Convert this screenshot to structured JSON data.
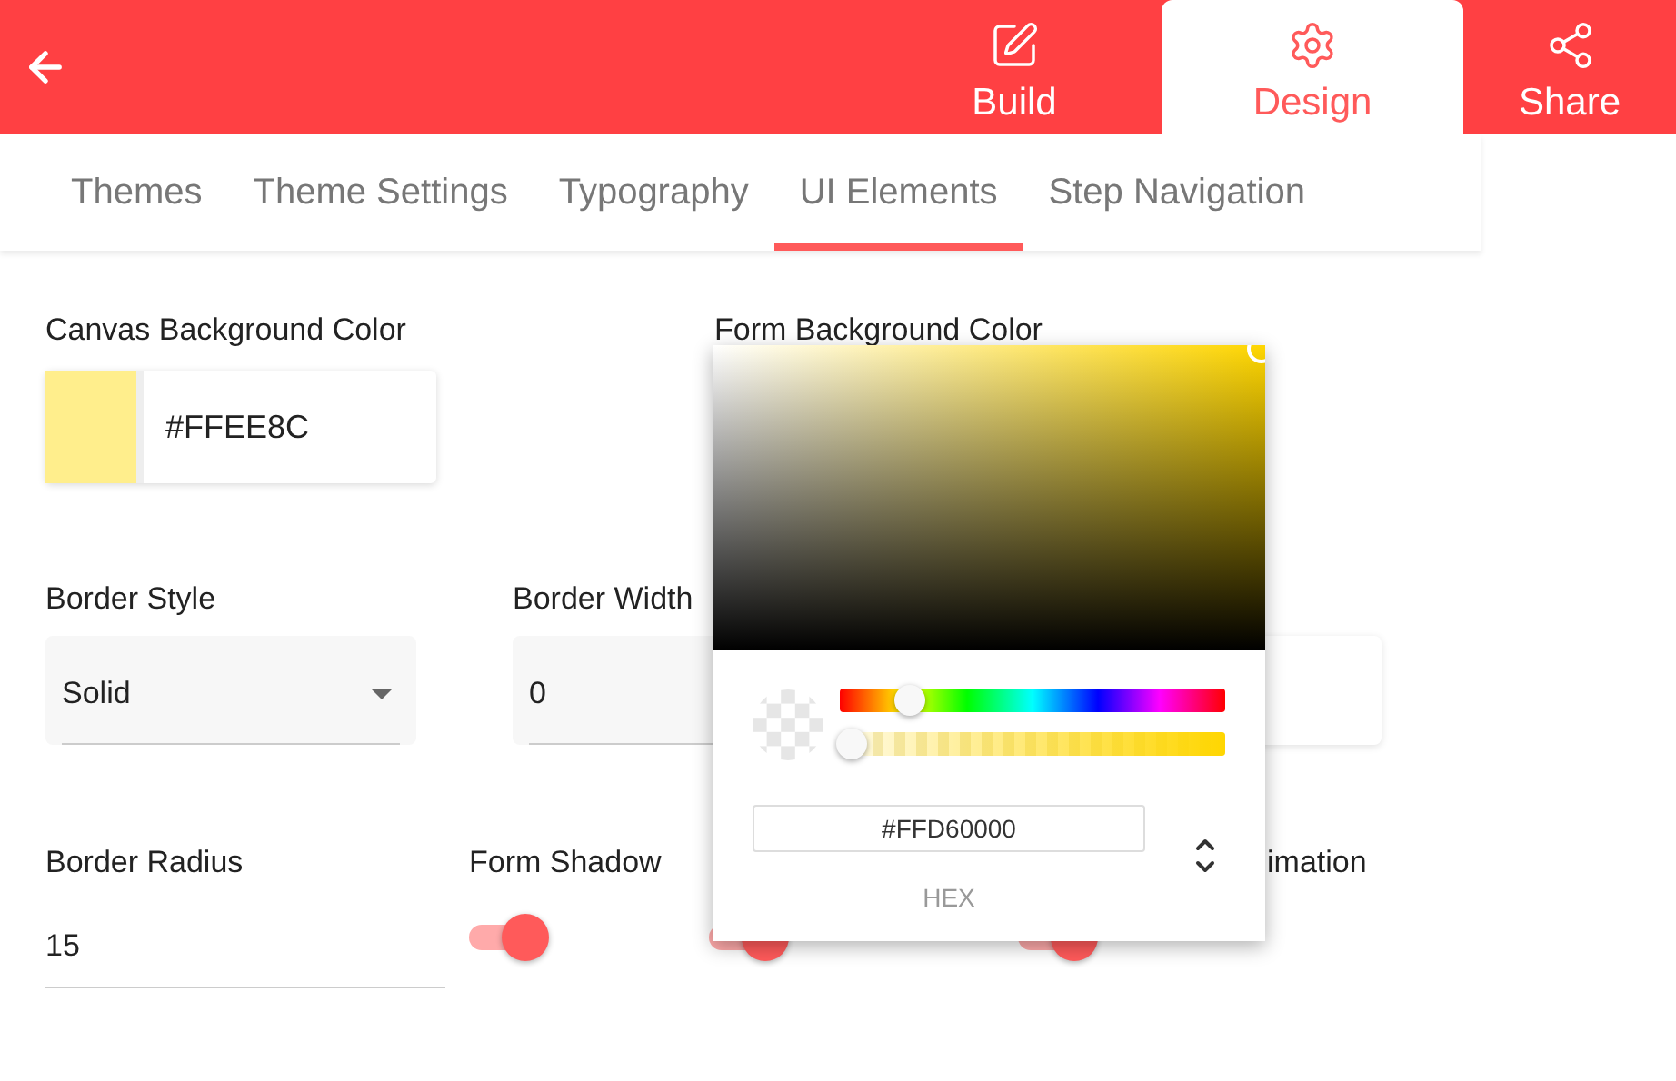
{
  "header": {
    "tabs": [
      {
        "label": "Build",
        "selected": false
      },
      {
        "label": "Design",
        "selected": true
      },
      {
        "label": "Share",
        "selected": false
      }
    ]
  },
  "subtabs": [
    {
      "label": "Themes",
      "selected": false
    },
    {
      "label": "Theme Settings",
      "selected": false
    },
    {
      "label": "Typography",
      "selected": false
    },
    {
      "label": "UI Elements",
      "selected": true
    },
    {
      "label": "Step Navigation",
      "selected": false
    }
  ],
  "colors": [
    {
      "label": "Canvas Background Color",
      "value": "#FFEE8C",
      "color": "#ffee8c"
    },
    {
      "label": "Form Background Color"
    }
  ],
  "row2": [
    {
      "kind": "select",
      "label": "Border Style",
      "value": "Solid"
    },
    {
      "kind": "input",
      "label": "Border Width",
      "value": "0"
    },
    {
      "kind": "card"
    }
  ],
  "row3": [
    {
      "kind": "text",
      "label": "Border Radius",
      "value": "15"
    },
    {
      "kind": "toggle",
      "label": "Form Shadow",
      "on": true
    },
    {
      "kind": "toggle",
      "on": true
    },
    {
      "kind": "toggle",
      "label": "imation",
      "on": true
    }
  ],
  "picker": {
    "hex": "#FFD60000",
    "format": "HEX",
    "hue": {
      "level": 0.15
    },
    "alpha": {
      "level": 0
    }
  }
}
